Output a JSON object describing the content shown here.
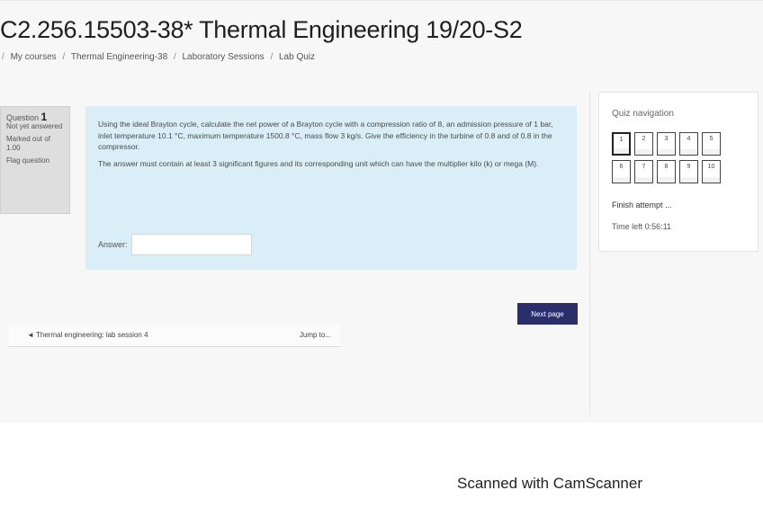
{
  "page": {
    "title": "C2.256.15503-38* Thermal Engineering 19/20-S2",
    "breadcrumb": [
      "My courses",
      "Thermal Engineering-38",
      "Laboratory Sessions",
      "Lab Quiz"
    ],
    "breadcrumb_sep": "/"
  },
  "question_info": {
    "label": "Question",
    "number": "1",
    "status": "Not yet answered",
    "marks": "Marked out of 1.00",
    "flag": "Flag question"
  },
  "question": {
    "text1": "Using the ideal Brayton cycle, calculate the net power of a Brayton cycle with a compression ratio of 8, an admission pressure of 1 bar, inlet temperature 10.1 °C, maximum temperature 1500.8 °C, mass flow 3 kg/s. Give the efficiency in the turbine of 0.8 and of 0.8 in the compressor.",
    "text2": "The answer must contain at least 3 significant figures and its corresponding unit which can have the multiplier kilo (k) or mega (M).",
    "answer_label": "Answer:",
    "answer_value": "",
    "answer_placeholder": ""
  },
  "buttons": {
    "next_page": "Next page"
  },
  "jump": {
    "prev_link": "◄ Thermal engineering: lab session 4",
    "select_label": "Jump to..."
  },
  "quiz_nav": {
    "title": "Quiz navigation",
    "row1": [
      "1",
      "2",
      "3",
      "4",
      "5"
    ],
    "row2": [
      "6",
      "7",
      "8",
      "9",
      "10"
    ],
    "finish": "Finish attempt ...",
    "time_left": "Time left 0:56:11"
  },
  "watermark": "Scanned with CamScanner"
}
